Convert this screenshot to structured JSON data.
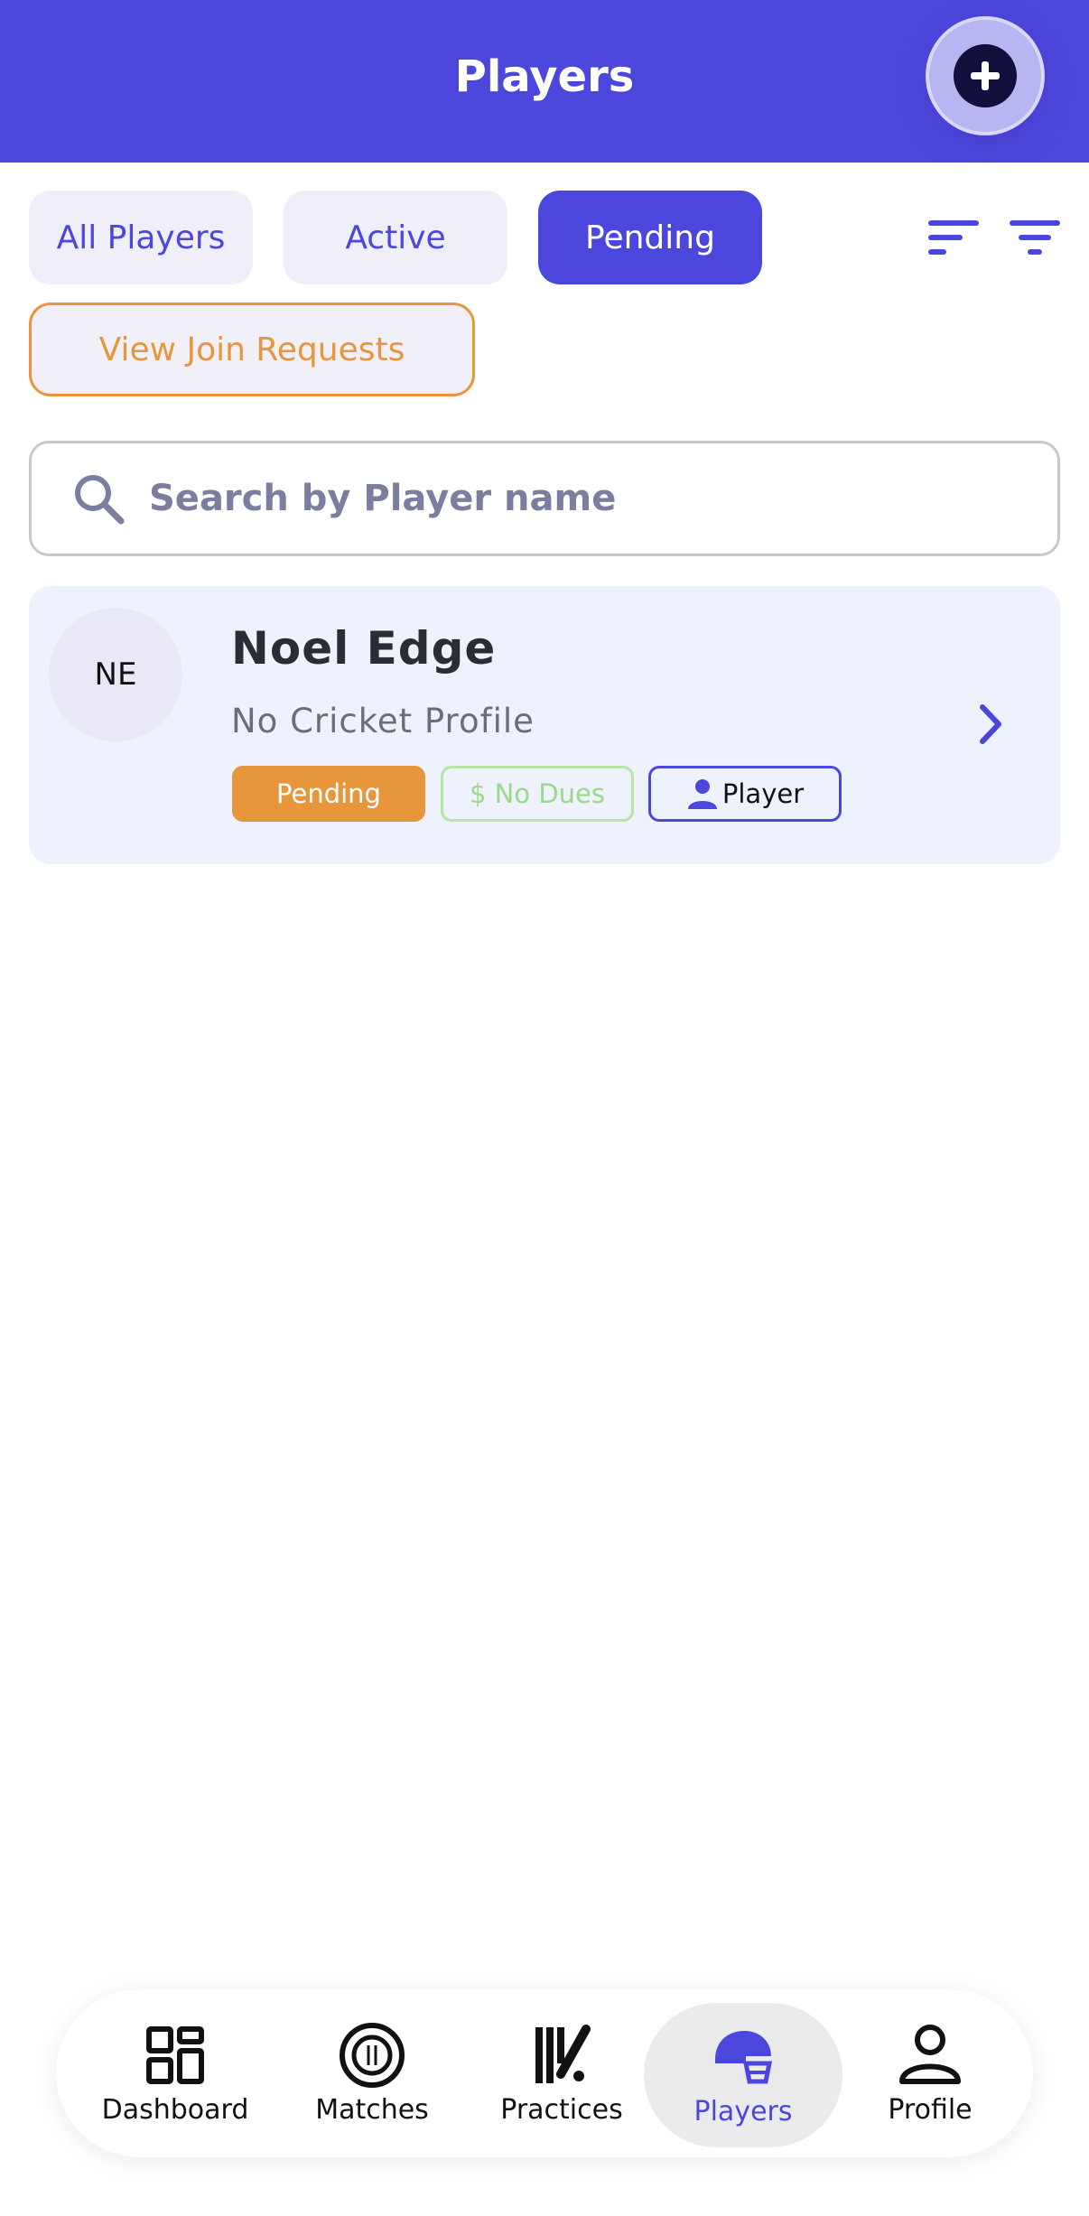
{
  "header": {
    "title": "Players"
  },
  "tabs": [
    {
      "label": "All Players"
    },
    {
      "label": "Active"
    },
    {
      "label": "Pending"
    }
  ],
  "join_requests_label": "View Join Requests",
  "search": {
    "placeholder": "Search by Player name",
    "value": ""
  },
  "players": [
    {
      "initials": "NE",
      "name": "Noel Edge",
      "subtitle": "No Cricket Profile",
      "status_badge": "Pending",
      "dues_badge": "$ No Dues",
      "role_badge": "Player"
    }
  ],
  "nav": [
    {
      "label": "Dashboard",
      "icon": "dashboard-icon"
    },
    {
      "label": "Matches",
      "icon": "matches-icon"
    },
    {
      "label": "Practices",
      "icon": "practices-icon"
    },
    {
      "label": "Players",
      "icon": "helmet-icon",
      "active": true
    },
    {
      "label": "Profile",
      "icon": "profile-icon"
    }
  ],
  "colors": {
    "primary": "#4c47dc",
    "pending": "#e8963c",
    "no_dues": "#9bd98a",
    "card_bg": "#eef2fc"
  }
}
